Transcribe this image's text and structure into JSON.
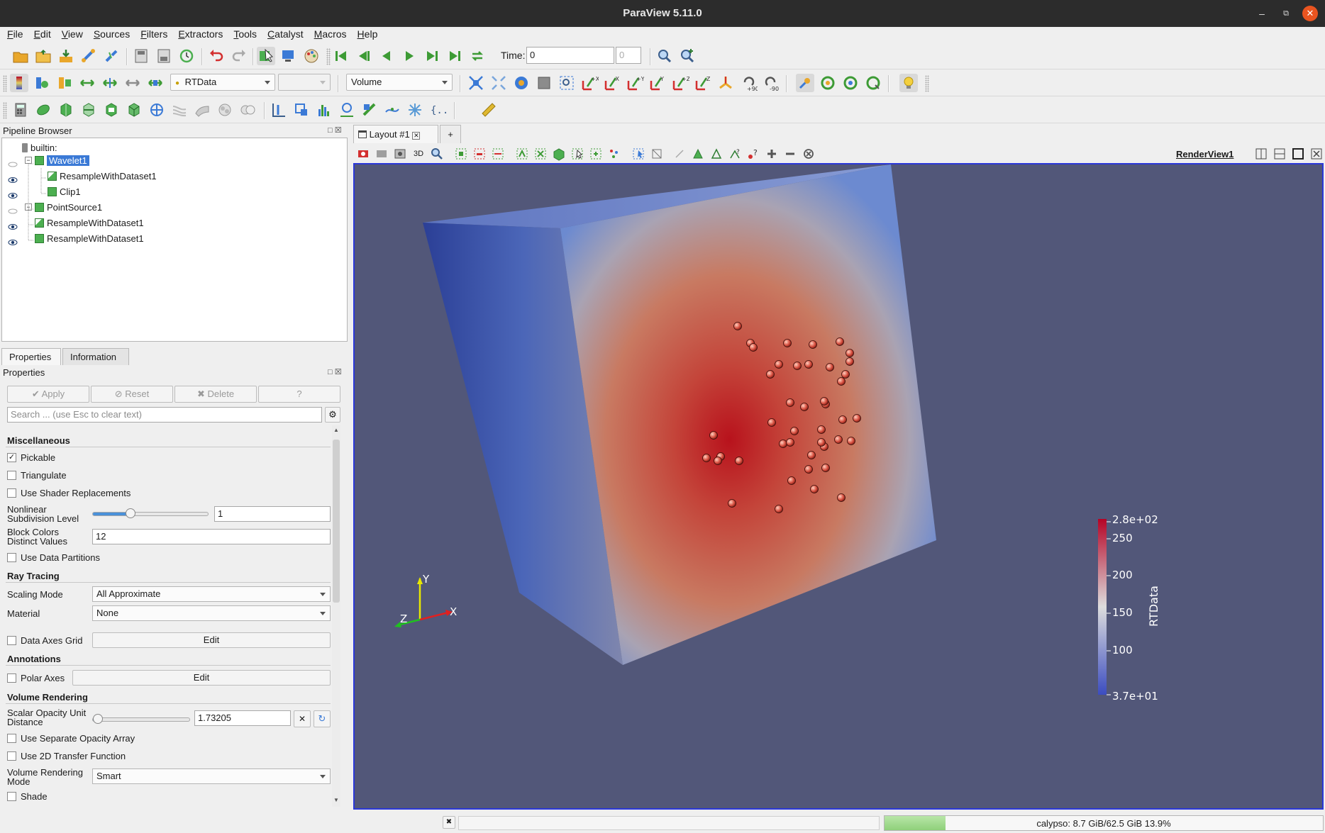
{
  "window": {
    "title": "ParaView 5.11.0"
  },
  "menu": [
    "File",
    "Edit",
    "View",
    "Sources",
    "Filters",
    "Extractors",
    "Tools",
    "Catalyst",
    "Macros",
    "Help"
  ],
  "toolbar": {
    "time_label": "Time:",
    "time_value": "0",
    "time_step": "0",
    "array_combo": "RTData",
    "array_combo_icon": "point-data-icon",
    "component_combo": "",
    "representation_combo": "Volume",
    "rotate_plus90": "+90",
    "rotate_minus90": "-90",
    "axis_labels": [
      "+X",
      "-X",
      "+Y",
      "-Y",
      "+Z",
      "-Z"
    ]
  },
  "pipeline": {
    "title": "Pipeline Browser",
    "items": [
      {
        "label": "builtin:",
        "icon": "server-icon",
        "level": 0
      },
      {
        "label": "Wavelet1",
        "icon": "source-icon",
        "level": 1,
        "selected": true,
        "visible": "hidden"
      },
      {
        "label": "ResampleWithDataset1",
        "icon": "filter-icon",
        "level": 2,
        "visible": "visible"
      },
      {
        "label": "Clip1",
        "icon": "source-icon",
        "level": 2,
        "visible": "visible"
      },
      {
        "label": "PointSource1",
        "icon": "source-icon",
        "level": 1,
        "visible": "hidden"
      },
      {
        "label": "ResampleWithDataset1",
        "icon": "filter-icon",
        "level": 1,
        "visible": "visible"
      },
      {
        "label": "ResampleWithDataset1",
        "icon": "source-icon",
        "level": 1,
        "visible": "visible"
      }
    ]
  },
  "panel_tabs": [
    "Properties",
    "Information"
  ],
  "properties": {
    "title": "Properties",
    "apply": "Apply",
    "reset": "Reset",
    "delete": "Delete",
    "help": "?",
    "search_placeholder": "Search ... (use Esc to clear text)",
    "sections": {
      "misc": "Miscellaneous",
      "ray": "Ray Tracing",
      "annotations": "Annotations",
      "volume": "Volume Rendering"
    },
    "pickable": "Pickable",
    "pickable_checked": true,
    "triangulate": "Triangulate",
    "shader_replacements": "Use Shader Replacements",
    "nonlinear_label_1": "Nonlinear",
    "nonlinear_label_2": "Subdivision Level",
    "nonlinear_value": "1",
    "nonlinear_slider": 0.33,
    "block_colors_label_1": "Block Colors",
    "block_colors_label_2": "Distinct Values",
    "block_colors_value": "12",
    "data_partitions": "Use Data Partitions",
    "scaling_mode_label": "Scaling Mode",
    "scaling_mode_value": "All Approximate",
    "material_label": "Material",
    "material_value": "None",
    "data_axes_grid": "Data Axes Grid",
    "edit": "Edit",
    "polar_axes": "Polar Axes",
    "scalar_opacity_label_1": "Scalar Opacity Unit",
    "scalar_opacity_label_2": "Distance",
    "scalar_opacity_value": "1.73205",
    "scalar_opacity_slider": 0.05,
    "separate_opacity": "Use Separate Opacity Array",
    "transfer_2d": "Use 2D Transfer Function",
    "volume_mode_label_1": "Volume Rendering",
    "volume_mode_label_2": "Mode",
    "volume_mode_value": "Smart",
    "shade": "Shade"
  },
  "layout": {
    "tab_label": "Layout #1",
    "add_tab": "+",
    "view_name": "RenderView1",
    "view_3d_label": "3D"
  },
  "colorbar": {
    "title": "RTData",
    "max_label": "2.8e+02",
    "min_label": "3.7e+01",
    "ticks": [
      "250",
      "200",
      "150",
      "100"
    ],
    "colors": {
      "low": "#3b4cc0",
      "mid": "#dddddd",
      "high": "#b40426"
    }
  },
  "axes": {
    "x": "X",
    "y": "Y",
    "z": "Z"
  },
  "status": {
    "memory": "calypso: 8.7 GiB/62.5 GiB 13.9%",
    "memory_fraction": 0.139
  }
}
